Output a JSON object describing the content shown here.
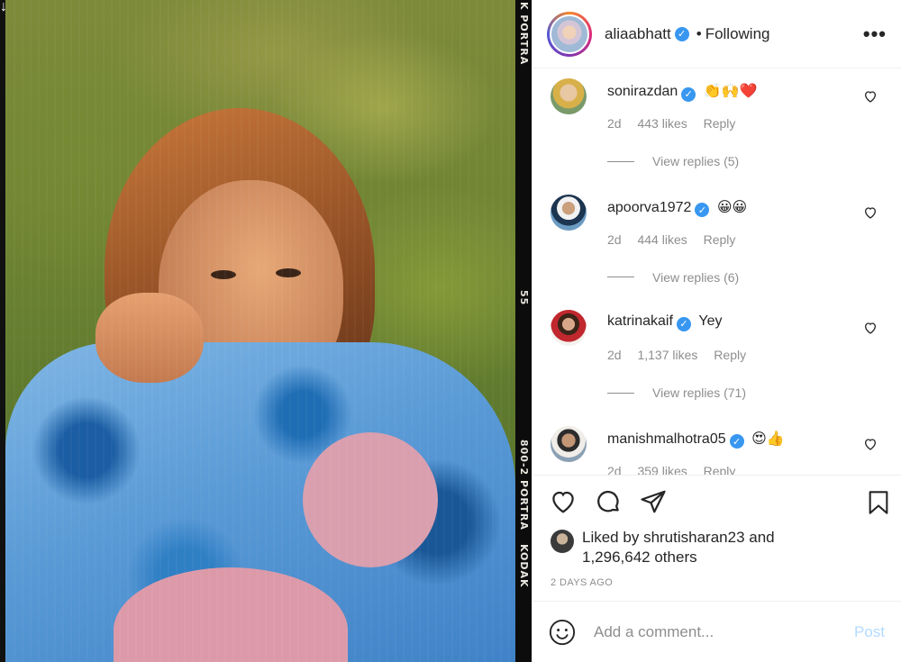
{
  "photo": {
    "film_strip": [
      "K  PORTRA",
      "55",
      "800-2 PORTRA",
      "KODAK"
    ],
    "arrow_icon": "down-arrow-icon"
  },
  "header": {
    "username": "aliaabhatt",
    "separator": "•",
    "follow_state": "Following",
    "more_icon": "more-options-icon",
    "more_label": "•••"
  },
  "comments": [
    {
      "username": "sonirazdan",
      "verified": true,
      "text": "👏🙌❤️",
      "age": "2d",
      "likes": "443 likes",
      "reply": "Reply",
      "view_replies": "View replies (5)"
    },
    {
      "username": "apoorva1972",
      "verified": true,
      "text": "😀😀",
      "age": "2d",
      "likes": "444 likes",
      "reply": "Reply",
      "view_replies": "View replies (6)"
    },
    {
      "username": "katrinakaif",
      "verified": true,
      "text": "Yey",
      "age": "2d",
      "likes": "1,137 likes",
      "reply": "Reply",
      "view_replies": "View replies (71)"
    },
    {
      "username": "manishmalhotra05",
      "verified": true,
      "text": "😍👍",
      "age": "2d",
      "likes": "359 likes",
      "reply": "Reply",
      "view_replies": ""
    }
  ],
  "actions": {
    "like_icon": "heart-icon",
    "comment_icon": "comment-icon",
    "share_icon": "share-icon",
    "save_icon": "bookmark-icon"
  },
  "likes": {
    "prefix": "Liked by",
    "user": "shrutisharan23",
    "conjunction": "and",
    "others": "1,296,642 others"
  },
  "posted": "2 DAYS AGO",
  "composer": {
    "placeholder": "Add a comment...",
    "post_label": "Post"
  },
  "colors": {
    "verified": "#3897f0",
    "post_disabled": "#b3dbff",
    "muted": "#8e8e8e"
  }
}
